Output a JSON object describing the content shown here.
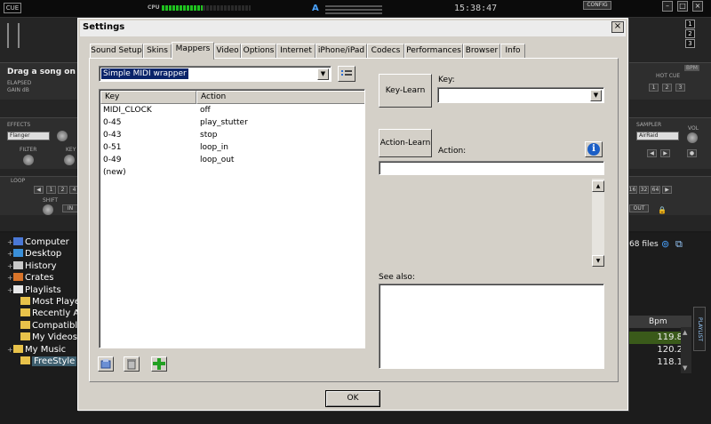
{
  "app": {
    "logo": "CUE",
    "cpu_label": "CPU",
    "deck_letter": "A",
    "clock": "15:38:47",
    "config_label": "CONFIG",
    "window_numbers": [
      "1",
      "2",
      "3"
    ],
    "drag_text": "Drag a song on thi",
    "elapsed_label": "ELAPSED",
    "gain_label": "GAIN dB",
    "hot_cue_label": "HOT CUE",
    "bpm_badge": "BPM",
    "hot_cue_buttons": [
      "1",
      "2",
      "3"
    ],
    "effects_label": "EFFECTS",
    "effect_value": "Flanger",
    "filter_label": "FILTER",
    "key_label": "KEY",
    "loop_label": "LOOP",
    "shift_label": "SHIFT",
    "in_label": "IN",
    "out_label": "OUT",
    "loop_buttons": [
      "1",
      "2",
      "4"
    ],
    "loop_buttons_right": [
      "16",
      "32",
      "64"
    ],
    "sampler_label": "SAMPLER",
    "sampler_value": "AirRaid",
    "vol_label": "VOL",
    "files_count": "68 files",
    "side_tab_label": "PLAYLIST",
    "bpm_header": "Bpm",
    "bpm_values": [
      "119.8",
      "120.2",
      "118.1"
    ]
  },
  "tree": [
    {
      "label": "Computer",
      "expander": "+",
      "icon": "computer-icon"
    },
    {
      "label": "Desktop",
      "expander": "+",
      "icon": "desktop-icon"
    },
    {
      "label": "History",
      "expander": "+",
      "icon": "history-icon"
    },
    {
      "label": "Crates",
      "expander": "+",
      "icon": "crates-icon"
    },
    {
      "label": "Playlists",
      "expander": "+",
      "icon": "playlists-icon"
    },
    {
      "label": "Most Played",
      "expander": "",
      "icon": "folder-icon"
    },
    {
      "label": "Recently Add",
      "expander": "",
      "icon": "folder-icon"
    },
    {
      "label": "Compatible S",
      "expander": "",
      "icon": "folder-icon"
    },
    {
      "label": "My Videos",
      "expander": "",
      "icon": "folder-icon"
    },
    {
      "label": "My Music",
      "expander": "+",
      "icon": "folder-icon"
    },
    {
      "label": "FreeStyle",
      "expander": "",
      "icon": "folder-icon"
    }
  ],
  "dialog": {
    "title": "Settings",
    "close": "×",
    "tabs": [
      "Sound Setup",
      "Skins",
      "Mappers",
      "Video",
      "Options",
      "Internet",
      "iPhone/iPad",
      "Codecs",
      "Performances",
      "Browser",
      "Info"
    ],
    "active_tab": "Mappers",
    "mapper_select": "Simple MIDI wrapper",
    "columns": {
      "key": "Key",
      "action": "Action"
    },
    "rows": [
      {
        "key": "MIDI_CLOCK",
        "action": "off"
      },
      {
        "key": "0-45",
        "action": "play_stutter"
      },
      {
        "key": "0-43",
        "action": "stop"
      },
      {
        "key": "0-51",
        "action": "loop_in"
      },
      {
        "key": "0-49",
        "action": "loop_out"
      },
      {
        "key": "(new)",
        "action": ""
      }
    ],
    "key_learn": "Key-Learn",
    "key_label": "Key:",
    "key_value": "",
    "action_learn": "Action-Learn",
    "action_label": "Action:",
    "action_value": "",
    "see_also_label": "See also:",
    "ok": "OK"
  }
}
